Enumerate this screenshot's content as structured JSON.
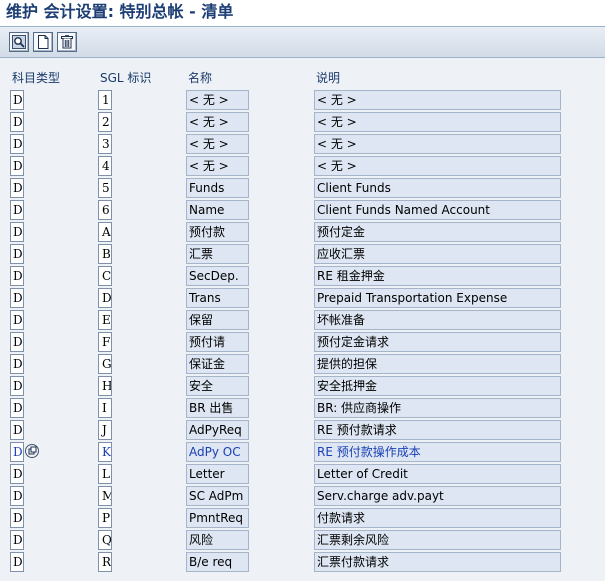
{
  "title": "维护 会计设置: 特别总帐 - 清单",
  "toolbar": {
    "buttons": [
      {
        "name": "details-button",
        "icon": "magnifier-icon"
      },
      {
        "name": "new-entries-button",
        "icon": "new-document-icon"
      },
      {
        "name": "delete-button",
        "icon": "trash-icon"
      }
    ]
  },
  "columns": {
    "type": "科目类型",
    "sgl": "SGL 标识",
    "name": "名称",
    "desc": "说明"
  },
  "rows": [
    {
      "type": "D",
      "sgl": "1",
      "name": "< 无 >",
      "desc": "< 无 >"
    },
    {
      "type": "D",
      "sgl": "2",
      "name": "< 无 >",
      "desc": "< 无 >"
    },
    {
      "type": "D",
      "sgl": "3",
      "name": "< 无 >",
      "desc": "< 无 >"
    },
    {
      "type": "D",
      "sgl": "4",
      "name": "< 无 >",
      "desc": "< 无 >"
    },
    {
      "type": "D",
      "sgl": "5",
      "name": "Funds",
      "desc": "Client Funds"
    },
    {
      "type": "D",
      "sgl": "6",
      "name": "Name",
      "desc": "Client Funds Named Account"
    },
    {
      "type": "D",
      "sgl": "A",
      "name": "预付款",
      "desc": "预付定金"
    },
    {
      "type": "D",
      "sgl": "B",
      "name": "汇票",
      "desc": "应收汇票"
    },
    {
      "type": "D",
      "sgl": "C",
      "name": "SecDep.",
      "desc": "RE 租金押金"
    },
    {
      "type": "D",
      "sgl": "D",
      "name": "Trans",
      "desc": "Prepaid Transportation Expense"
    },
    {
      "type": "D",
      "sgl": "E",
      "name": "保留",
      "desc": "坏帐准备"
    },
    {
      "type": "D",
      "sgl": "F",
      "name": "预付请",
      "desc": "预付定金请求"
    },
    {
      "type": "D",
      "sgl": "G",
      "name": "保证金",
      "desc": "提供的担保"
    },
    {
      "type": "D",
      "sgl": "H",
      "name": "安全",
      "desc": "安全抵押金"
    },
    {
      "type": "D",
      "sgl": "I",
      "name": "BR 出售",
      "desc": "BR: 供应商操作"
    },
    {
      "type": "D",
      "sgl": "J",
      "name": "AdPyReq",
      "desc": "RE 预付款请求"
    },
    {
      "type": "D",
      "sgl": "K",
      "name": "AdPy OC",
      "desc": "RE 预付款操作成本",
      "selected": true
    },
    {
      "type": "D",
      "sgl": "L",
      "name": "Letter",
      "desc": "Letter of Credit"
    },
    {
      "type": "D",
      "sgl": "M",
      "name": "SC AdPm",
      "desc": "Serv.charge adv.payt"
    },
    {
      "type": "D",
      "sgl": "P",
      "name": "PmntReq",
      "desc": "付款请求"
    },
    {
      "type": "D",
      "sgl": "Q",
      "name": "风险",
      "desc": "汇票剩余风险"
    },
    {
      "type": "D",
      "sgl": "R",
      "name": "B/e req",
      "desc": "汇票付款请求"
    }
  ]
}
